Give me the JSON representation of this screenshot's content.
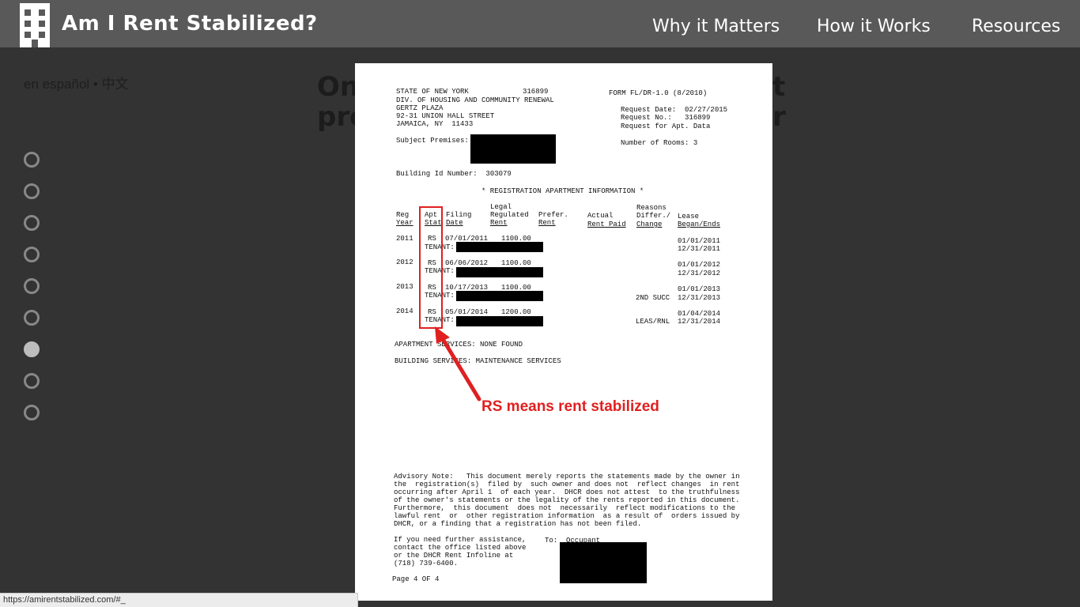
{
  "header": {
    "title": "Am I Rent Stabilized?",
    "nav": [
      "Why it Matters",
      "How it Works",
      "Resources"
    ]
  },
  "lang_links": "en español • 中文",
  "background_heading": {
    "line1_start": "On",
    "line1_end": "t",
    "line2_start": "pre",
    "line2_end": "r"
  },
  "slide_dots": {
    "count": 9,
    "active_index": 6
  },
  "document": {
    "agency": {
      "line1": "STATE OF NEW YORK",
      "line1_num": "316899",
      "line2": "DIV. OF HOUSING AND COMMUNITY RENEWAL",
      "line3": "GERTZ PLAZA",
      "line4": "92-31 UNION HALL STREET",
      "line5": "JAMAICA, NY  11433"
    },
    "form_id": "FORM FL/DR-1.0 (8/2010)",
    "request_date": "Request Date:  02/27/2015",
    "request_no": "Request No.:   316899",
    "request_for": "Request for Apt. Data",
    "subject_premises": "Subject Premises:",
    "number_of_rooms": "Number of Rooms: 3",
    "building_id": "Building Id Number:  303079",
    "section_title": "* REGISTRATION APARTMENT INFORMATION *",
    "columns": {
      "reg_year": [
        "Reg",
        "Year"
      ],
      "apt_stat": [
        "Apt",
        "Stat"
      ],
      "filing_date": [
        "Filing",
        "Date"
      ],
      "legal_rent": [
        "Legal",
        "Regulated",
        "Rent"
      ],
      "pref_rent": [
        "Prefer.",
        "Rent"
      ],
      "actual_rent": [
        "Actual",
        "Rent Paid"
      ],
      "reasons": [
        "Reasons",
        "Differ./",
        "Change"
      ],
      "lease": [
        "Lease",
        "Began/Ends"
      ]
    },
    "rows": [
      {
        "year": "2011",
        "stat": "RS",
        "date": "07/01/2011",
        "rent": "1100.00",
        "reason": "",
        "began": "01/01/2011",
        "ends": "12/31/2011",
        "tenant": "TENANT:"
      },
      {
        "year": "2012",
        "stat": "RS",
        "date": "06/06/2012",
        "rent": "1100.00",
        "reason": "",
        "began": "01/01/2012",
        "ends": "12/31/2012",
        "tenant": "TENANT:"
      },
      {
        "year": "2013",
        "stat": "RS",
        "date": "10/17/2013",
        "rent": "1100.00",
        "reason": "2ND SUCC",
        "began": "01/01/2013",
        "ends": "12/31/2013",
        "tenant": "TENANT:"
      },
      {
        "year": "2014",
        "stat": "RS",
        "date": "05/01/2014",
        "rent": "1200.00",
        "reason": "LEAS/RNL",
        "began": "01/04/2014",
        "ends": "12/31/2014",
        "tenant": "TENANT:"
      }
    ],
    "apartment_services": "APARTMENT SERVICES: NONE FOUND",
    "building_services": "BUILDING SERVICES: MAINTENANCE SERVICES",
    "annotation": "RS means rent stabilized",
    "annotation_color": "#e02020",
    "advisory": [
      "Advisory Note:   This document merely reports the statements made by the owner in",
      "the  registration(s)  filed by  such owner and does not  reflect changes  in rent",
      "occurring after April 1  of each year.  DHCR does not attest  to the truthfulness",
      "of the owner's statements or the legality of the rents reported in this document.",
      "Furthermore,  this document  does not  necessarily  reflect modifications to the",
      "lawful rent  or  other registration information  as a result of  orders issued by",
      "DHCR, or a finding that a registration has not been filed."
    ],
    "assistance": [
      "If you need further assistance,",
      "contact the office listed above",
      "or the DHCR Rent Infoline at",
      "(718) 739-6400."
    ],
    "to_occupant": "To:  Occupant",
    "page": "Page 4 OF 4"
  },
  "status_url": "https://amirentstabilized.com/#_"
}
